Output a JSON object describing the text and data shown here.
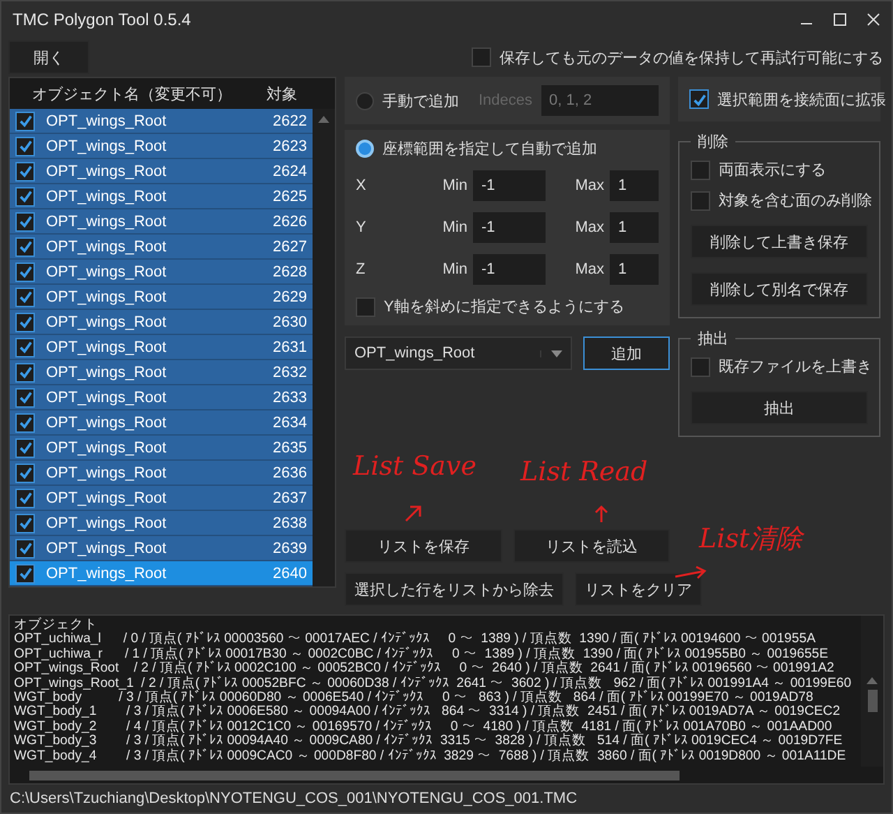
{
  "window": {
    "title": "TMC Polygon Tool 0.5.4"
  },
  "toolbar": {
    "open_button": "開く",
    "keep_checkbox": {
      "label": "保存しても元のデータの値を保持して再試行可能にする",
      "checked": false
    }
  },
  "object_list": {
    "columns": [
      "オブジェクト名（変更不可）",
      "対象"
    ],
    "rows": [
      {
        "name": "OPT_wings_Root",
        "target": "2622",
        "checked": true,
        "selected": false
      },
      {
        "name": "OPT_wings_Root",
        "target": "2623",
        "checked": true,
        "selected": false
      },
      {
        "name": "OPT_wings_Root",
        "target": "2624",
        "checked": true,
        "selected": false
      },
      {
        "name": "OPT_wings_Root",
        "target": "2625",
        "checked": true,
        "selected": false
      },
      {
        "name": "OPT_wings_Root",
        "target": "2626",
        "checked": true,
        "selected": false
      },
      {
        "name": "OPT_wings_Root",
        "target": "2627",
        "checked": true,
        "selected": false
      },
      {
        "name": "OPT_wings_Root",
        "target": "2628",
        "checked": true,
        "selected": false
      },
      {
        "name": "OPT_wings_Root",
        "target": "2629",
        "checked": true,
        "selected": false
      },
      {
        "name": "OPT_wings_Root",
        "target": "2630",
        "checked": true,
        "selected": false
      },
      {
        "name": "OPT_wings_Root",
        "target": "2631",
        "checked": true,
        "selected": false
      },
      {
        "name": "OPT_wings_Root",
        "target": "2632",
        "checked": true,
        "selected": false
      },
      {
        "name": "OPT_wings_Root",
        "target": "2633",
        "checked": true,
        "selected": false
      },
      {
        "name": "OPT_wings_Root",
        "target": "2634",
        "checked": true,
        "selected": false
      },
      {
        "name": "OPT_wings_Root",
        "target": "2635",
        "checked": true,
        "selected": false
      },
      {
        "name": "OPT_wings_Root",
        "target": "2636",
        "checked": true,
        "selected": false
      },
      {
        "name": "OPT_wings_Root",
        "target": "2637",
        "checked": true,
        "selected": false
      },
      {
        "name": "OPT_wings_Root",
        "target": "2638",
        "checked": true,
        "selected": false
      },
      {
        "name": "OPT_wings_Root",
        "target": "2639",
        "checked": true,
        "selected": false
      },
      {
        "name": "OPT_wings_Root",
        "target": "2640",
        "checked": true,
        "selected": true
      }
    ]
  },
  "manual_add": {
    "label": "手動で追加",
    "selected": false,
    "indices_label": "Indeces",
    "indices_value": "0, 1, 2",
    "disabled": true
  },
  "auto_add": {
    "label": "座標範囲を指定して自動で追加",
    "selected": true,
    "axes": [
      {
        "axis": "X",
        "min_label": "Min",
        "min": "-1",
        "max_label": "Max",
        "max": "1"
      },
      {
        "axis": "Y",
        "min_label": "Min",
        "min": "-1",
        "max_label": "Max",
        "max": "1"
      },
      {
        "axis": "Z",
        "min_label": "Min",
        "min": "-1",
        "max_label": "Max",
        "max": "1"
      }
    ],
    "diagonal_checkbox": {
      "label": "Y軸を斜めに指定できるようにする",
      "checked": false
    }
  },
  "object_select": {
    "value": "OPT_wings_Root"
  },
  "add_button": "追加",
  "expand_checkbox": {
    "label": "選択範囲を接続面に拡張",
    "checked": true
  },
  "delete_group": {
    "title": "削除",
    "checkboxes": [
      {
        "label": "両面表示にする",
        "checked": false
      },
      {
        "label": "対象を含む面のみ削除",
        "checked": false
      }
    ],
    "buttons": [
      "削除して上書き保存",
      "削除して別名で保存"
    ]
  },
  "extract_group": {
    "title": "抽出",
    "checkboxes": [
      {
        "label": "既存ファイルを上書き",
        "checked": false
      }
    ],
    "buttons": [
      "抽出"
    ]
  },
  "list_buttons": [
    "リストを保存",
    "リストを読込",
    "選択した行をリストから除去",
    "リストをクリア"
  ],
  "annotations": [
    {
      "text": "List Save"
    },
    {
      "text": "List Read"
    },
    {
      "text": "List清除"
    }
  ],
  "log": {
    "lines": [
      "オブジェクト",
      "OPT_uchiwa_l      / 0 / 頂点( ｱﾄﾞﾚｽ 00003560 ～ 00017AEC / ｲﾝﾃﾞｯｸｽ     0 ～  1389 ) / 頂点数  1390 / 面( ｱﾄﾞﾚｽ 00194600 ～ 001955A",
      "OPT_uchiwa_r      / 1 / 頂点( ｱﾄﾞﾚｽ 00017B30 ～ 0002C0BC / ｲﾝﾃﾞｯｸｽ     0 ～  1389 ) / 頂点数  1390 / 面( ｱﾄﾞﾚｽ 001955B0 ～ 0019655E",
      "OPT_wings_Root    / 2 / 頂点( ｱﾄﾞﾚｽ 0002C100 ～ 00052BC0 / ｲﾝﾃﾞｯｸｽ     0 ～  2640 ) / 頂点数  2641 / 面( ｱﾄﾞﾚｽ 00196560 ～ 001991A2",
      "OPT_wings_Root_1  / 2 / 頂点( ｱﾄﾞﾚｽ 00052BFC ～ 00060D38 / ｲﾝﾃﾞｯｸｽ  2641 ～  3602 ) / 頂点数   962 / 面( ｱﾄﾞﾚｽ 001991A4 ～ 00199E60",
      "WGT_body          / 3 / 頂点( ｱﾄﾞﾚｽ 00060D80 ～ 0006E540 / ｲﾝﾃﾞｯｸｽ     0 ～   863 ) / 頂点数   864 / 面( ｱﾄﾞﾚｽ 00199E70 ～ 0019AD78",
      "WGT_body_1        / 3 / 頂点( ｱﾄﾞﾚｽ 0006E580 ～ 00094A00 / ｲﾝﾃﾞｯｸｽ   864 ～  3314 ) / 頂点数  2451 / 面( ｱﾄﾞﾚｽ 0019AD7A ～ 0019CEC2",
      "WGT_body_2        / 4 / 頂点( ｱﾄﾞﾚｽ 0012C1C0 ～ 00169570 / ｲﾝﾃﾞｯｸｽ     0 ～  4180 ) / 頂点数  4181 / 面( ｱﾄﾞﾚｽ 001A70B0 ～ 001AAD00",
      "WGT_body_3        / 3 / 頂点( ｱﾄﾞﾚｽ 00094A40 ～ 0009CA80 / ｲﾝﾃﾞｯｸｽ  3315 ～  3828 ) / 頂点数   514 / 面( ｱﾄﾞﾚｽ 0019CEC4 ～ 0019D7FE",
      "WGT_body_4        / 3 / 頂点( ｱﾄﾞﾚｽ 0009CAC0 ～ 000D8F80 / ｲﾝﾃﾞｯｸｽ  3829 ～  7688 ) / 頂点数  3860 / 面( ｱﾄﾞﾚｽ 0019D800 ～ 001A11DE"
    ]
  },
  "status_bar": {
    "path": "C:\\Users\\Tzuchiang\\Desktop\\NYOTENGU_COS_001\\NYOTENGU_COS_001.TMC"
  }
}
